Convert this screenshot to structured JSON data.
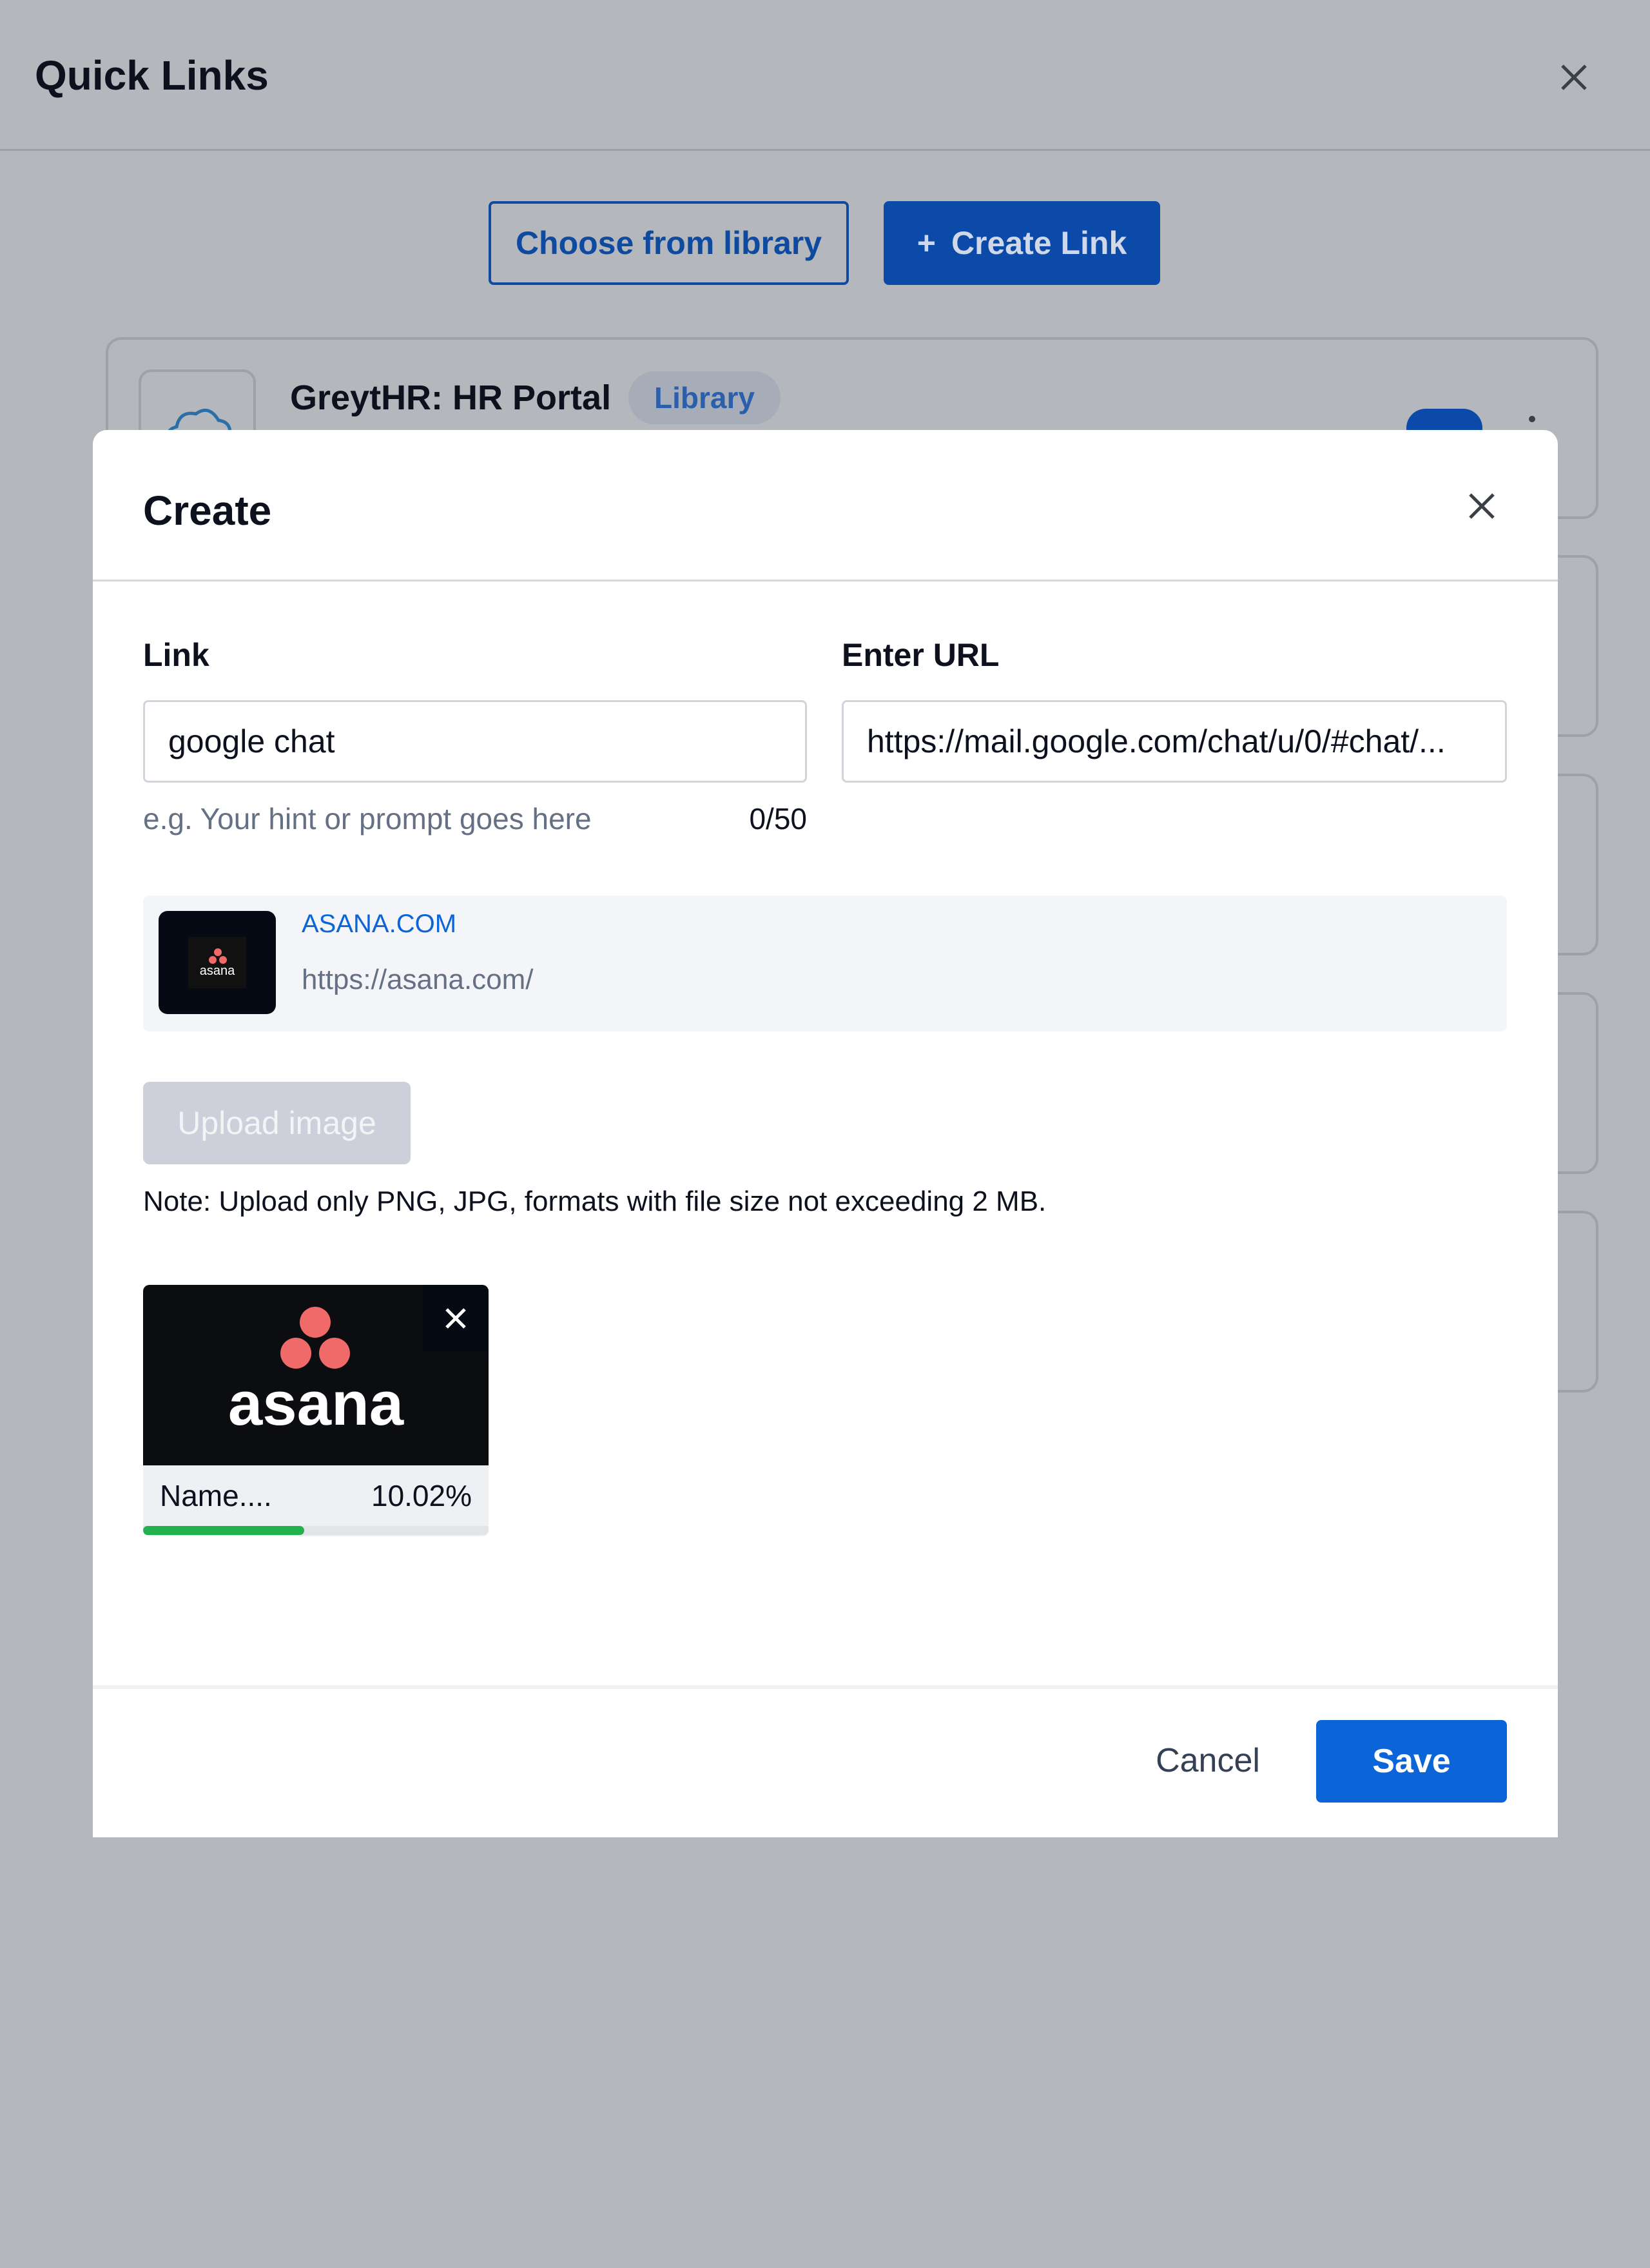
{
  "page": {
    "title": "Quick Links"
  },
  "toolbar": {
    "choose_label": "Choose from library",
    "create_label": "Create Link",
    "create_icon": "plus-icon"
  },
  "background_card": {
    "title": "GreytHR: HR Portal",
    "badge": "Library",
    "enabled": true
  },
  "modal": {
    "title": "Create",
    "link_label": "Link",
    "link_value": "google chat",
    "link_hint": "e.g. Your hint or prompt goes here",
    "link_count": "0/50",
    "url_label": "Enter URL",
    "url_value": "https://mail.google.com/chat/u/0/#chat/...",
    "preview": {
      "site": "ASANA.COM",
      "url": "https://asana.com/",
      "logo_text": "asana"
    },
    "upload_label": "Upload image",
    "note": "Note: Upload only PNG, JPG, formats with file size not exceeding 2 MB.",
    "upload_item": {
      "logo_text": "asana",
      "name": "Name....",
      "progress_label": "10.02%",
      "progress": 10.02
    },
    "cancel_label": "Cancel",
    "save_label": "Save"
  },
  "colors": {
    "primary": "#0b65d8",
    "progress": "#22b14c",
    "asana": "#f06a6a"
  }
}
